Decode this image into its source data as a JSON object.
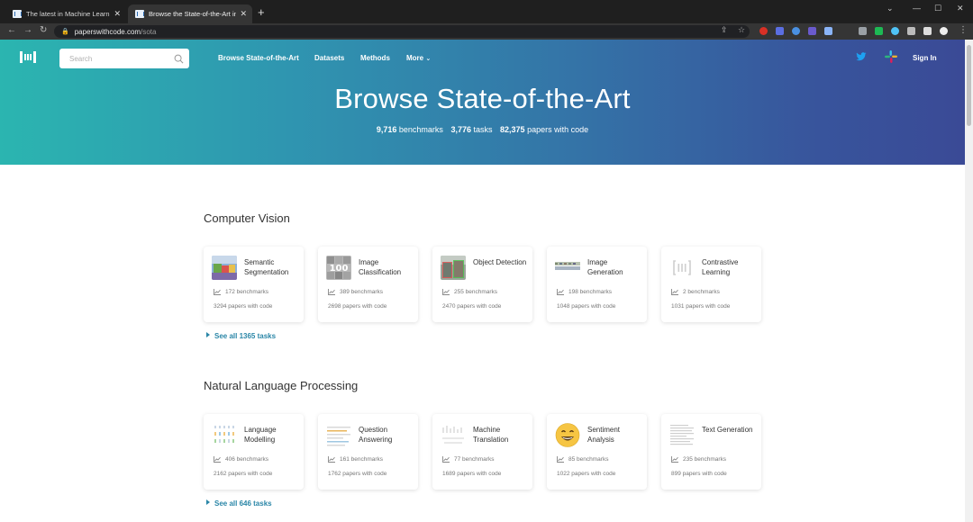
{
  "browser": {
    "tabs": [
      {
        "title": "The latest in Machine Learning",
        "active": false
      },
      {
        "title": "Browse the State-of-the-Art in",
        "active": true
      }
    ],
    "url_host": "paperswithcode.com",
    "url_path": "/sota"
  },
  "header": {
    "search_placeholder": "Search",
    "nav": [
      "Browse State-of-the-Art",
      "Datasets",
      "Methods",
      "More"
    ],
    "signin": "Sign In"
  },
  "hero": {
    "title": "Browse State-of-the-Art",
    "benchmarks_count": "9,716",
    "benchmarks_label": "benchmarks",
    "tasks_count": "3,776",
    "tasks_label": "tasks",
    "papers_count": "82,375",
    "papers_label": "papers with code"
  },
  "sections": [
    {
      "title": "Computer Vision",
      "see_all": "See all 1365 tasks",
      "cards": [
        {
          "name": "Semantic Segmentation",
          "benchmarks": "172 benchmarks",
          "papers": "3294 papers with code",
          "thumb": "segmentation-thumbnail"
        },
        {
          "name": "Image Classification",
          "benchmarks": "389 benchmarks",
          "papers": "2698 papers with code",
          "thumb": "classification-thumbnail"
        },
        {
          "name": "Object Detection",
          "benchmarks": "255 benchmarks",
          "papers": "2470 papers with code",
          "thumb": "detection-thumbnail"
        },
        {
          "name": "Image Generation",
          "benchmarks": "198 benchmarks",
          "papers": "1048 papers with code",
          "thumb": "generation-thumbnail"
        },
        {
          "name": "Contrastive Learning",
          "benchmarks": "2 benchmarks",
          "papers": "1031 papers with code",
          "thumb": "pwc-logo-thumbnail"
        }
      ]
    },
    {
      "title": "Natural Language Processing",
      "see_all": "See all 646 tasks",
      "cards": [
        {
          "name": "Language Modelling",
          "benchmarks": "406 benchmarks",
          "papers": "2162 papers with code",
          "thumb": "language-modelling-thumbnail"
        },
        {
          "name": "Question Answering",
          "benchmarks": "161 benchmarks",
          "papers": "1762 papers with code",
          "thumb": "question-answering-thumbnail"
        },
        {
          "name": "Machine Translation",
          "benchmarks": "77 benchmarks",
          "papers": "1689 papers with code",
          "thumb": "translation-thumbnail"
        },
        {
          "name": "Sentiment Analysis",
          "benchmarks": "85 benchmarks",
          "papers": "1022 papers with code",
          "thumb": "smiley-emoji-thumbnail"
        },
        {
          "name": "Text Generation",
          "benchmarks": "235 benchmarks",
          "papers": "899 papers with code",
          "thumb": "text-document-thumbnail"
        }
      ]
    }
  ]
}
